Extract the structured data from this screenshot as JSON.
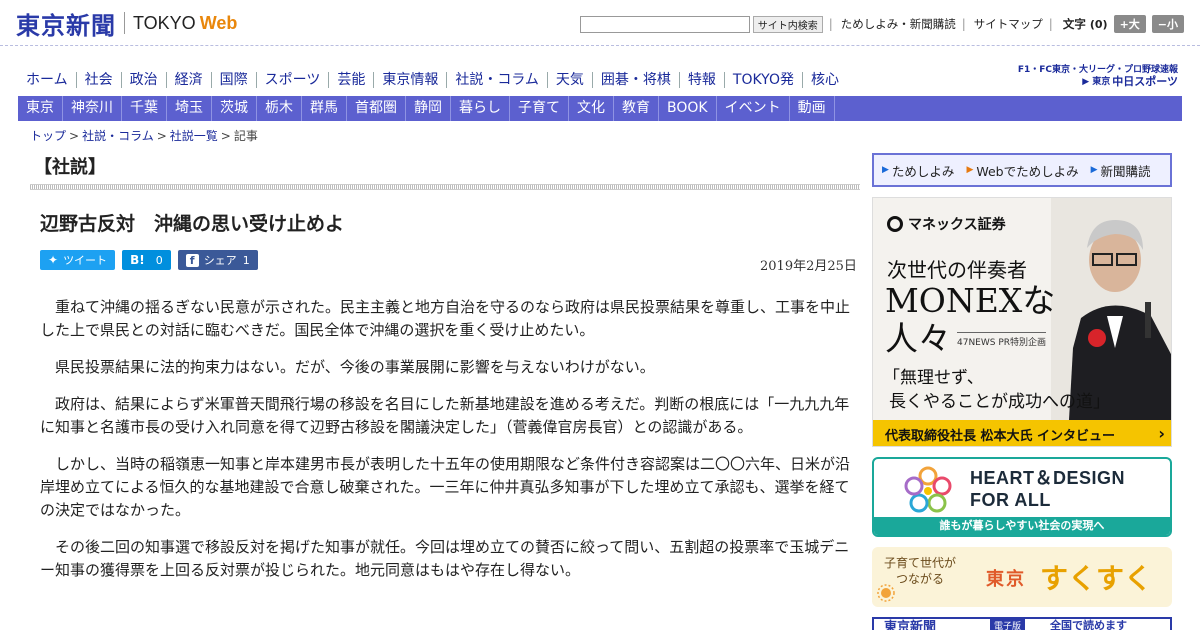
{
  "header": {
    "logo_jp": "東京新聞",
    "logo_en": "TOKYO",
    "logo_web": "Web",
    "search_placeholder": "",
    "search_button": "サイト内検索",
    "links": [
      "ためしよみ・新聞購読",
      "サイトマップ"
    ],
    "font_label": "文字",
    "font_count": "(0)",
    "font_larger": "+大",
    "font_smaller": "−小"
  },
  "nav_main": [
    "ホーム",
    "社会",
    "政治",
    "経済",
    "国際",
    "スポーツ",
    "芸能",
    "東京情報",
    "社説・コラム",
    "天気",
    "囲碁・将棋",
    "特報",
    "TOKYO発",
    "核心"
  ],
  "sports": {
    "line1": "F1・FC東京・大リーグ・プロ野球速報",
    "brand_prefix": "東京",
    "brand_name": "中日スポーツ"
  },
  "nav_region": [
    "東京",
    "神奈川",
    "千葉",
    "埼玉",
    "茨城",
    "栃木",
    "群馬",
    "首都圏",
    "静岡",
    "暮らし",
    "子育て",
    "文化",
    "教育",
    "BOOK",
    "イベント",
    "動画"
  ],
  "breadcrumb": [
    "トップ",
    "社説・コラム",
    "社説一覧",
    "記事"
  ],
  "article": {
    "section": "【社説】",
    "headline": "辺野古反対　沖縄の思い受け止めよ",
    "date": "2019年2月25日",
    "share": {
      "tweet": "ツイート",
      "hatena_label": "B!",
      "hatena_count": "0",
      "fb_label": "シェア",
      "fb_count": "1"
    },
    "paragraphs": [
      "重ねて沖縄の揺るぎない民意が示された。民主主義と地方自治を守るのなら政府は県民投票結果を尊重し、工事を中止した上で県民との対話に臨むべきだ。国民全体で沖縄の選択を重く受け止めたい。",
      "県民投票結果に法的拘束力はない。だが、今後の事業展開に影響を与えないわけがない。",
      "政府は、結果によらず米軍普天間飛行場の移設を名目にした新基地建設を進める考えだ。判断の根底には「一九九九年に知事と名護市長の受け入れ同意を得て辺野古移設を閣議決定した」（菅義偉官房長官）との認識がある。",
      "しかし、当時の稲嶺恵一知事と岸本建男市長が表明した十五年の使用期限など条件付き容認案は二〇〇六年、日米が沿岸埋め立てによる恒久的な基地建設で合意し破棄された。一三年に仲井真弘多知事が下した埋め立て承認も、選挙を経ての決定ではなかった。",
      "その後二回の知事選で移設反対を掲げた知事が就任。今回は埋め立ての賛否に絞って問い、五割超の投票率で玉城デニー知事の獲得票を上回る反対票が投じられた。地元同意はもはや存在し得ない。"
    ]
  },
  "sidebar": {
    "links": [
      "ためしよみ",
      "Webでためしよみ",
      "新聞購読"
    ],
    "monex": {
      "logo": "マネックス証券",
      "sub": "次世代の伴奏者",
      "title": "MONEXな人々",
      "pr": "47NEWS PR特別企画",
      "quote_line1": "「無理せず、",
      "quote_line2": "長くやることが成功への道」",
      "bar": "代表取締役社長 松本大氏 インタビュー",
      "bar_arrow": "›"
    },
    "heart": {
      "title_line1": "HEART＆DESIGN",
      "title_line2": "FOR ALL",
      "bar": "誰もが暮らしやすい社会の実現へ"
    },
    "sukusuku": {
      "small_line1": "子育て世代が",
      "small_line2": "つながる",
      "tokyo": "東京",
      "big": "すくすく"
    },
    "bottom": {
      "text": "東京新聞",
      "badge": "電子版",
      "text2": "全国で読めます"
    }
  },
  "colors": {
    "brand_blue": "#2a3aa8",
    "region_nav": "#5c60cf",
    "accent_orange": "#e9870c",
    "monex_yellow": "#f5c400",
    "heart_teal": "#1aa89a"
  }
}
